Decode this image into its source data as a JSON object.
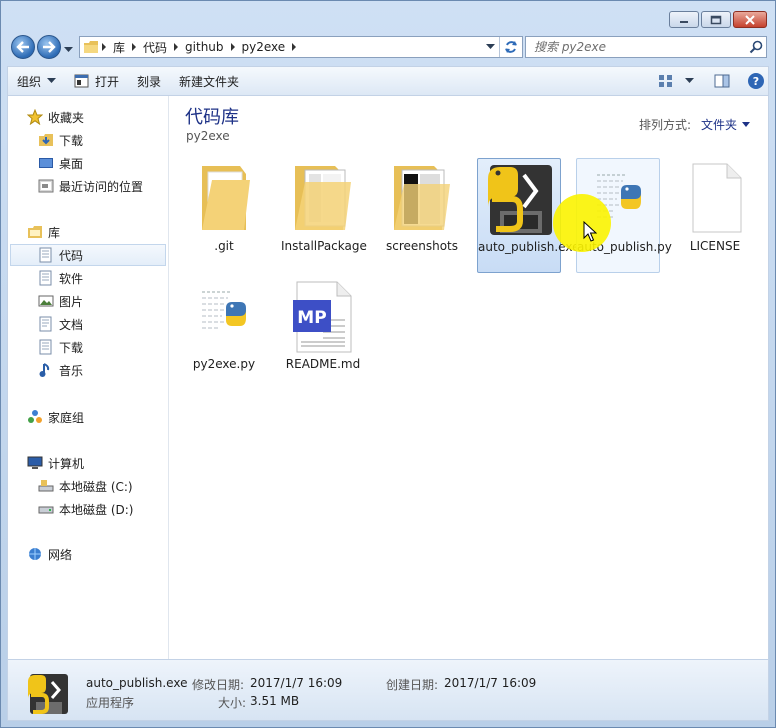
{
  "window": {
    "caption_buttons": [
      "minimize",
      "maximize",
      "close"
    ]
  },
  "address": {
    "segments": [
      "库",
      "代码",
      "github",
      "py2exe"
    ]
  },
  "search": {
    "placeholder": "搜索 py2exe"
  },
  "toolbar": {
    "organize": "组织",
    "open": "打开",
    "burn": "刻录",
    "new_folder": "新建文件夹"
  },
  "sidebar": {
    "favorites": {
      "label": "收藏夹",
      "items": [
        "下载",
        "桌面",
        "最近访问的位置"
      ]
    },
    "libraries": {
      "label": "库",
      "items": [
        "代码",
        "软件",
        "图片",
        "文档",
        "下载",
        "音乐"
      ]
    },
    "homegroup": "家庭组",
    "computer": {
      "label": "计算机",
      "items": [
        "本地磁盘 (C:)",
        "本地磁盘 (D:)"
      ]
    },
    "network": "网络"
  },
  "main": {
    "title": "代码库",
    "subtitle": "py2exe",
    "arrange_label": "排列方式:",
    "arrange_value": "文件夹"
  },
  "files": [
    {
      "name": ".git",
      "icon": "folder-icon"
    },
    {
      "name": "InstallPackage",
      "icon": "folder-icon"
    },
    {
      "name": "screenshots",
      "icon": "folder-icon"
    },
    {
      "name": "auto_publish.exe",
      "icon": "python-exe-icon",
      "selected": true
    },
    {
      "name": "auto_publish.py",
      "icon": "python-file-icon"
    },
    {
      "name": "LICENSE",
      "icon": "blank-file-icon"
    },
    {
      "name": "py2exe.py",
      "icon": "python-file-icon"
    },
    {
      "name": "README.md",
      "icon": "markdown-icon"
    }
  ],
  "details": {
    "file_name": "auto_publish.exe",
    "file_type": "应用程序",
    "modified_label": "修改日期:",
    "modified_value": "2017/1/7 16:09",
    "size_label": "大小:",
    "size_value": "3.51 MB",
    "created_label": "创建日期:",
    "created_value": "2017/1/7 16:09"
  },
  "colors": {
    "accent": "#1e3287",
    "selection": "#c8dcf5",
    "cursor_highlight": "#fbf300"
  }
}
